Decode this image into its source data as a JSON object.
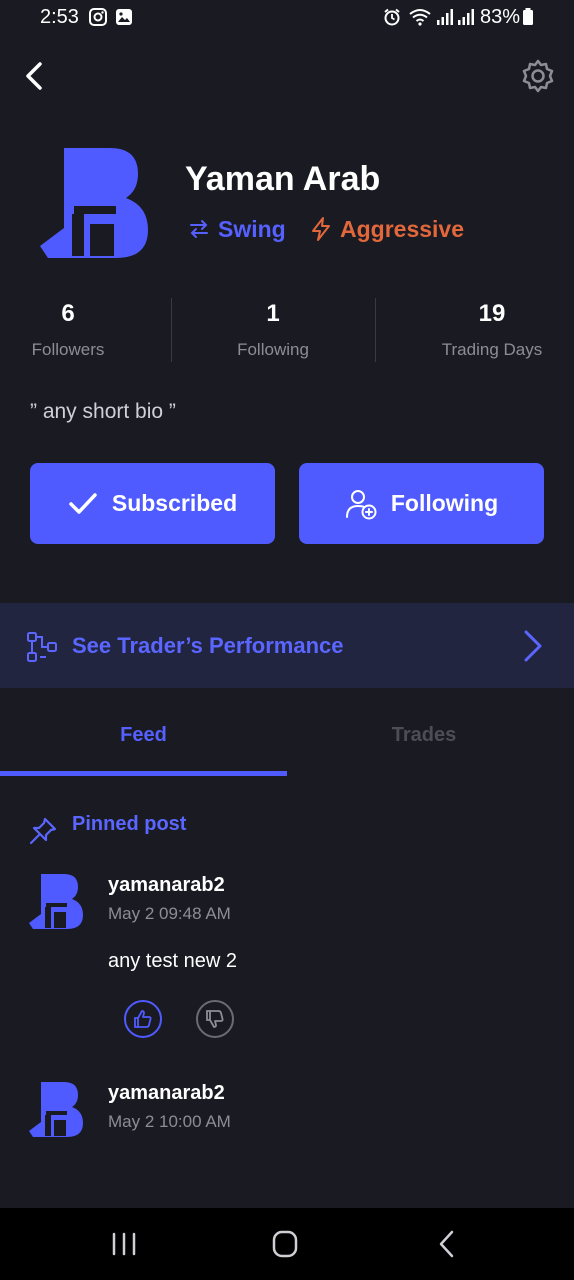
{
  "status_bar": {
    "time": "2:53",
    "battery": "83%"
  },
  "profile": {
    "name": "Yaman Arab",
    "style_tag": "Swing",
    "risk_tag": "Aggressive",
    "bio": "” any short bio ”"
  },
  "stats": [
    {
      "value": "6",
      "label": "Followers"
    },
    {
      "value": "1",
      "label": "Following"
    },
    {
      "value": "19",
      "label": "Trading Days"
    }
  ],
  "actions": {
    "subscribed_label": "Subscribed",
    "following_label": "Following"
  },
  "performance": {
    "label": "See Trader’s Performance"
  },
  "tabs": [
    {
      "label": "Feed",
      "active": true
    },
    {
      "label": "Trades",
      "active": false
    }
  ],
  "feed": {
    "pinned_label": "Pinned post",
    "posts": [
      {
        "username": "yamanarab2",
        "time": "May 2 09:48 AM",
        "body": "any test new 2"
      },
      {
        "username": "yamanarab2",
        "time": "May 2 10:00 AM"
      }
    ]
  },
  "colors": {
    "background": "#1a1a22",
    "accent": "#4f5bff",
    "aggressive": "#e2683c",
    "performance_bar": "#212540"
  }
}
